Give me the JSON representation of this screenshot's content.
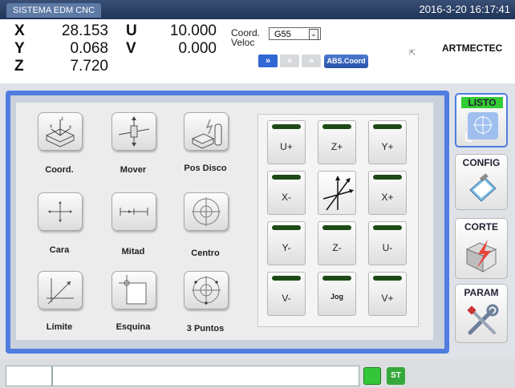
{
  "window": {
    "title": "SISTEMA EDM CNC",
    "datetime": "2016-3-20 16:17:41"
  },
  "axes": [
    {
      "label": "X",
      "value": "28.153"
    },
    {
      "label": "Y",
      "value": "0.068"
    },
    {
      "label": "Z",
      "value": "7.720"
    },
    {
      "label": "U",
      "value": "10.000"
    },
    {
      "label": "V",
      "value": "0.000"
    }
  ],
  "coord": {
    "label": "Coord.",
    "value": "G55"
  },
  "veloc": {
    "label": "Veloc",
    "buttons": [
      "»",
      "»",
      "»"
    ],
    "abs_label": "ABS.Coord"
  },
  "brand": "ARTMECTEC",
  "tools": [
    {
      "label": "Coord.",
      "icon": "coord-icon"
    },
    {
      "label": "Mover",
      "icon": "move-icon"
    },
    {
      "label": "Pos Disco",
      "icon": "disk-position-icon"
    },
    {
      "label": "Cara",
      "icon": "face-icon"
    },
    {
      "label": "Mitad",
      "icon": "midpoint-icon"
    },
    {
      "label": "Centro",
      "icon": "center-icon"
    },
    {
      "label": "Límite",
      "icon": "limit-icon"
    },
    {
      "label": "Esquina",
      "icon": "corner-icon"
    },
    {
      "label": "3 Puntos",
      "icon": "three-points-icon"
    }
  ],
  "jog": [
    "U+",
    "Z+",
    "Y+",
    "X-",
    "",
    "X+",
    "Y-",
    "Z-",
    "U-",
    "V-",
    "Jog",
    "V+"
  ],
  "side_buttons": [
    {
      "label": "LISTO",
      "icon": "target-icon"
    },
    {
      "label": "CONFIG",
      "icon": "clipboard-icon"
    },
    {
      "label": "CORTE",
      "icon": "cut-icon"
    },
    {
      "label": "PARAM",
      "icon": "tools-icon"
    }
  ],
  "status": {
    "field1": "",
    "field2": "",
    "st_label": "ST"
  },
  "colors": {
    "accent": "#4f7de0",
    "ready": "#33cc33",
    "led": "#1d4a16"
  }
}
